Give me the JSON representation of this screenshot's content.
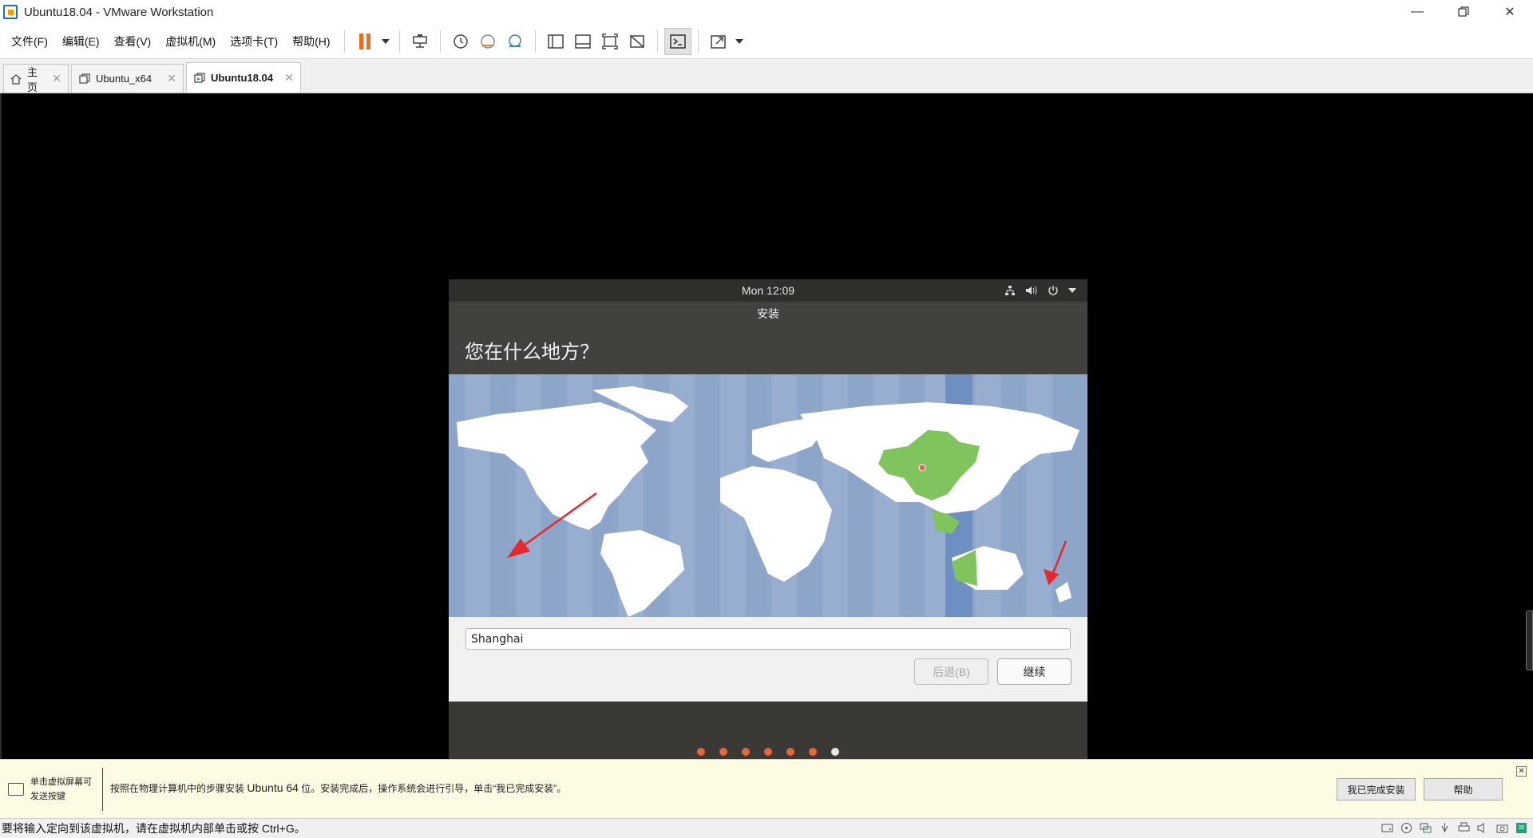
{
  "window": {
    "title": "Ubuntu18.04 - VMware Workstation"
  },
  "menu": [
    "文件(F)",
    "编辑(E)",
    "查看(V)",
    "虚拟机(M)",
    "选项卡(T)",
    "帮助(H)"
  ],
  "tabs": [
    {
      "label": "主页",
      "icon": "home-icon"
    },
    {
      "label": "Ubuntu_x64",
      "icon": "vm-icon"
    },
    {
      "label": "Ubuntu18.04",
      "icon": "vm-running-icon"
    }
  ],
  "guest": {
    "clock": "Mon 12:09",
    "window_title": "安装",
    "heading": "您在什么地方？",
    "timezone_value": "Shanghai",
    "back_label": "后退(B)",
    "continue_label": "继续",
    "progress": {
      "total": 7,
      "current": 7
    }
  },
  "hint": {
    "left_line1": "单击虚拟屏幕可",
    "left_line2": "发送按键",
    "message_part1": "按照在物理计算机中的步骤安装 ",
    "message_bold": "Ubuntu 64",
    "message_part2": " 位。安装完成后，操作系统会进行引导，单击“我已完成安装”。",
    "done_label": "我已完成安装",
    "help_label": "帮助"
  },
  "status": {
    "text": "要将输入定向到该虚拟机，请在虚拟机内部单击或按 Ctrl+G。"
  },
  "colors": {
    "accent": "#e4683b",
    "map_water": "#8da5c9",
    "selected_region": "#7fc45c",
    "arrow": "#e5282b"
  }
}
